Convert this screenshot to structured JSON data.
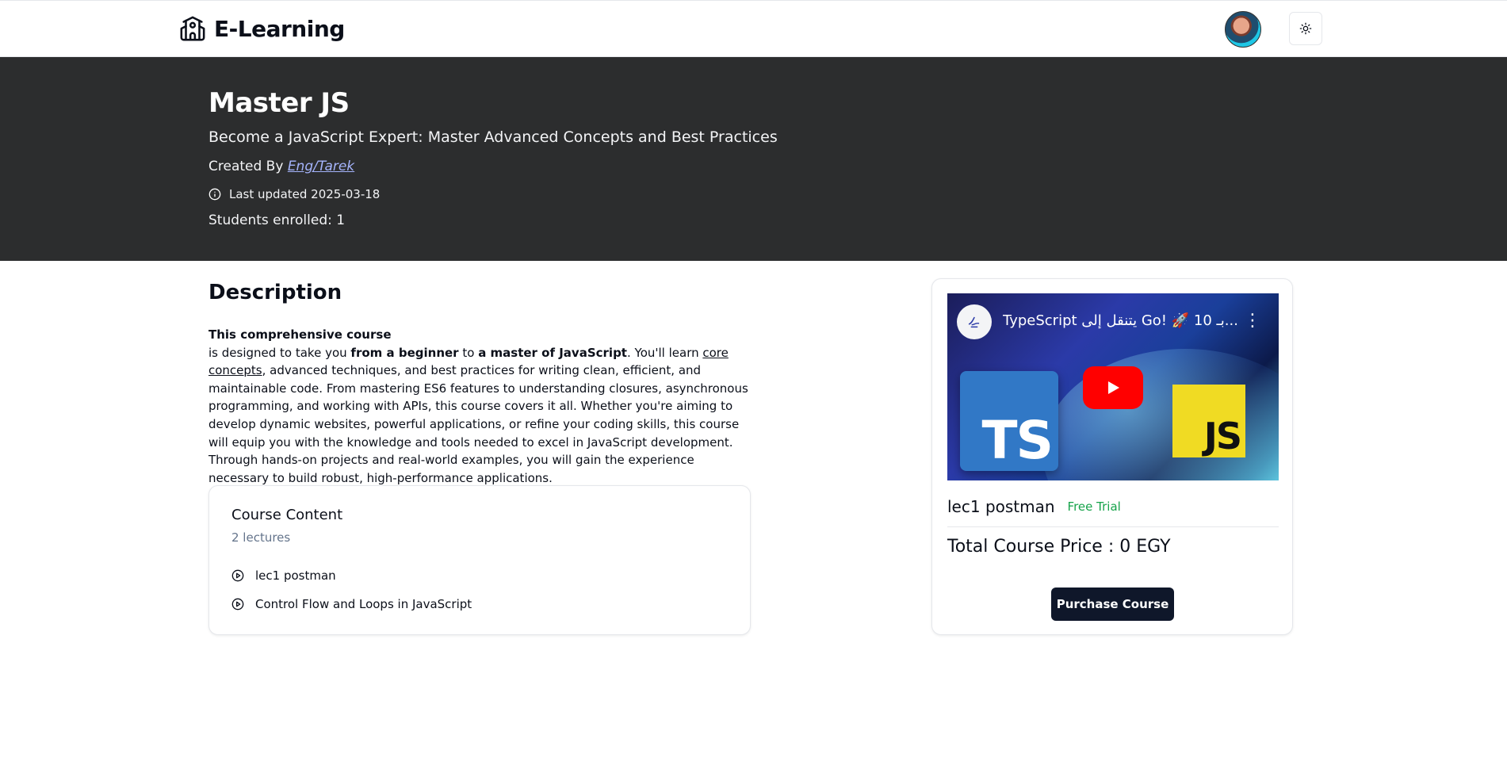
{
  "header": {
    "brand": "E-Learning",
    "brand_icon": "school-icon",
    "theme_icon": "sun-icon"
  },
  "hero": {
    "title": "Master JS",
    "subtitle": "Become a JavaScript Expert: Master Advanced Concepts and Best Practices",
    "created_by_label": "Created By",
    "creator": "Eng/Tarek",
    "last_updated": "Last updated 2025-03-18",
    "students": "Students enrolled: 1"
  },
  "description": {
    "heading": "Description",
    "lead": "This comprehensive course",
    "p1": "is designed to take you ",
    "b1": "from a beginner",
    "p2": " to ",
    "b2": "a master of JavaScript",
    "p3": ". You'll learn ",
    "u1": "core concepts",
    "p4": ", advanced techniques, and best practices for writing clean, efficient, and maintainable code. From mastering ES6 features to understanding closures, asynchronous programming, and working with APIs, this course covers it all. Whether you're aiming to develop dynamic websites, powerful applications, or refine your coding skills, this course will equip you with the knowledge and tools needed to excel in JavaScript development. Through hands-on projects and real-world examples, you will gain the experience necessary to build robust, high-performance applications."
  },
  "content": {
    "title": "Course Content",
    "count": "2 lectures",
    "lectures": [
      {
        "label": "lec1 postman"
      },
      {
        "label": "Control Flow and Loops in JavaScript"
      }
    ]
  },
  "preview": {
    "video_title": "TypeScript يتنقل إلى Go! 🚀 10 بـ...",
    "channel_icon": "channel-logo-icon",
    "ts_label": "TS",
    "js_label": "JS",
    "lecture": "lec1 postman",
    "tag": "Free Trial",
    "price": "Total Course Price : 0 EGY",
    "purchase_label": "Purchase Course"
  }
}
